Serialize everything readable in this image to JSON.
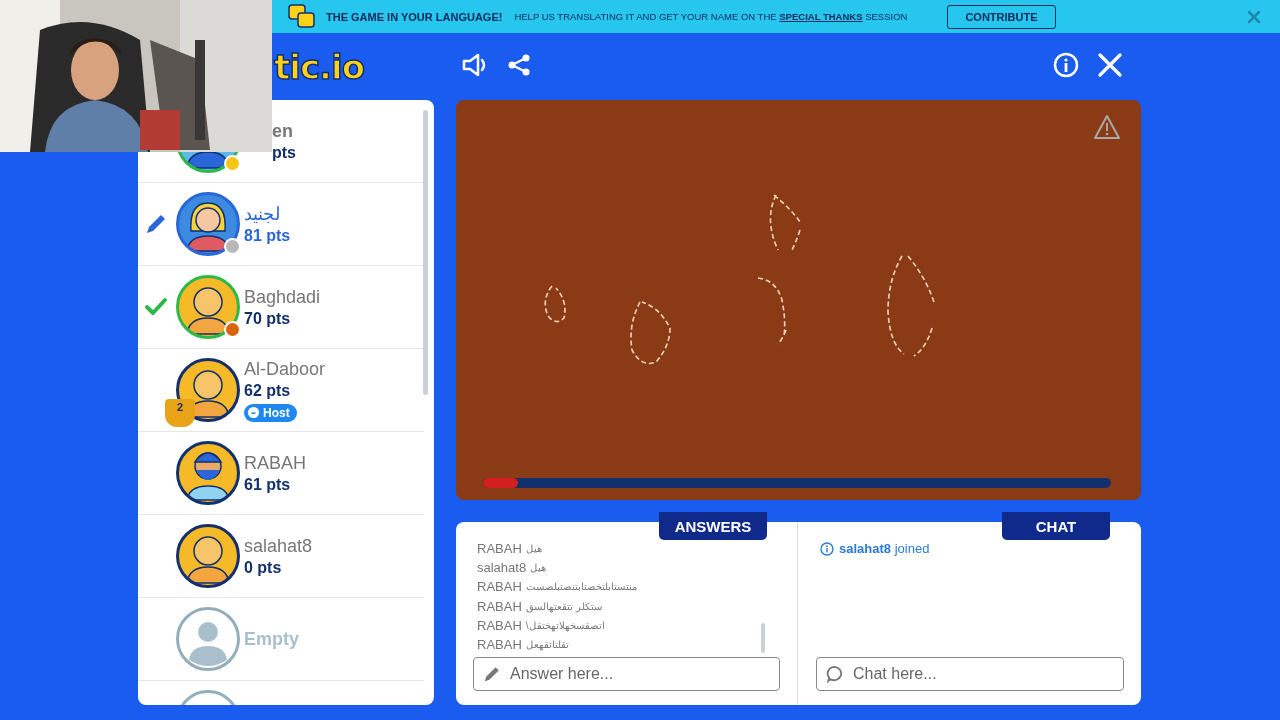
{
  "banner": {
    "headline": "THE GAME IN YOUR LANGUAGE!",
    "message_before": "HELP US TRANSLATING IT AND GET YOUR NAME ON THE",
    "link": "SPECIAL THANKS",
    "message_after": "SESSION",
    "button": "CONTRIBUTE"
  },
  "logo": "tic.io",
  "players": [
    {
      "name": "en",
      "cut": true,
      "points": "pts",
      "kind": "boy",
      "color": "#f5c518",
      "drawing": false,
      "guessed": true
    },
    {
      "name": "لجنيد",
      "points": "81 pts",
      "kind": "blonde",
      "color": "#b8b8b8",
      "drawing": true,
      "guessed": false
    },
    {
      "name": "Baghdadi",
      "points": "70 pts",
      "kind": "bald",
      "color": "#d9650b",
      "drawing": false,
      "guessed": true
    },
    {
      "name": "Al-Daboor",
      "points": "62 pts",
      "kind": "bald",
      "drawing": false,
      "guessed": false,
      "trophy": "2",
      "badge": "Host"
    },
    {
      "name": "RABAH",
      "points": "61 pts",
      "kind": "bearded",
      "drawing": false,
      "guessed": false
    },
    {
      "name": "salahat8",
      "points": "0 pts",
      "kind": "bald",
      "drawing": false,
      "guessed": false
    },
    {
      "name": "Empty",
      "kind": "empty"
    },
    {
      "kind": "empty"
    }
  ],
  "canvas": {
    "timer": {
      "level": 0.055
    }
  },
  "answers": {
    "tab": "ANSWERS",
    "entries": [
      {
        "name": "RABAH",
        "text": "هيل"
      },
      {
        "name": "salahat8",
        "text": "هيل"
      },
      {
        "name": "RABAH",
        "text": "منتستابلتخصتابتنصتبلصست"
      },
      {
        "name": "RABAH",
        "text": "ستكلر تتقعتهالسق"
      },
      {
        "name": "RABAH",
        "text": "اتصقسخهلاتهختقل\\"
      },
      {
        "name": "RABAH",
        "text": "تقلتاتقهعل"
      }
    ],
    "placeholder": "Answer here..."
  },
  "chat": {
    "tab": "CHAT",
    "messages": [
      {
        "kind": "system",
        "text": "**salahat8** joined"
      }
    ],
    "placeholder": "Chat here..."
  }
}
